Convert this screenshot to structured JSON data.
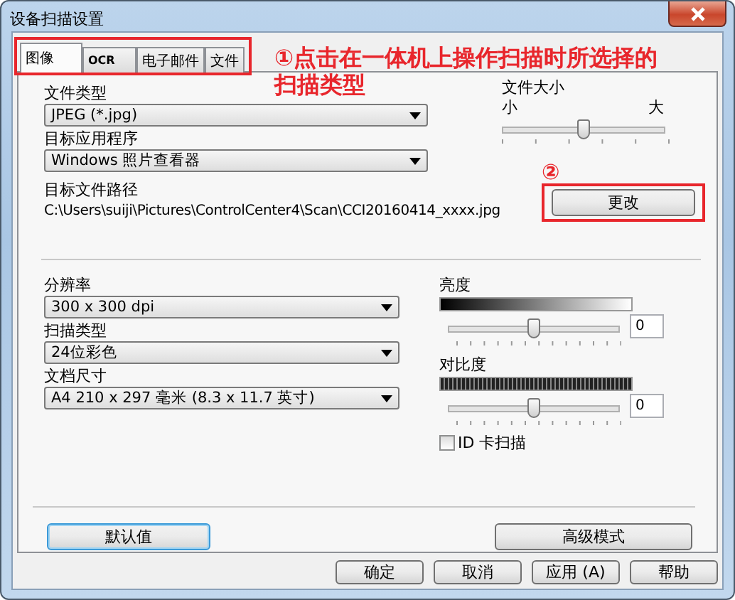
{
  "window": {
    "title": "设备扫描设置"
  },
  "tabs": [
    {
      "label": "图像",
      "selected": true
    },
    {
      "label": "OCR",
      "selected": false
    },
    {
      "label": "电子邮件",
      "selected": false
    },
    {
      "label": "文件",
      "selected": false
    }
  ],
  "tab_note": [
    "①点击在一体机上操作扫描时所选择的",
    "扫描类型"
  ],
  "file_type": {
    "label": "文件类型",
    "value": "JPEG (*.jpg)"
  },
  "file_size": {
    "label": "文件大小",
    "min_label": "小",
    "max_label": "大",
    "level": 0.5
  },
  "target_app": {
    "label": "目标应用程序",
    "value": "Windows 照片查看器"
  },
  "target_path": {
    "label": "目标文件路径",
    "value": "C:\\Users\\suiji\\Pictures\\ControlCenter4\\Scan\\CCI20160414_xxxx.jpg"
  },
  "change_button": {
    "note": "②",
    "label": "更改"
  },
  "resolution": {
    "label": "分辨率",
    "value": "300 x 300 dpi"
  },
  "scan_type": {
    "label": "扫描类型",
    "value": "24位彩色"
  },
  "document_size": {
    "label": "文档尺寸",
    "value": "A4 210 x 297 毫米 (8.3 x 11.7 英寸)"
  },
  "brightness": {
    "label": "亮度",
    "level": 0.5,
    "value": "0"
  },
  "contrast": {
    "label": "对比度",
    "level": 0.5,
    "value": "0"
  },
  "id_card_scan": {
    "label": "ID 卡扫描",
    "checked": false
  },
  "default_button": "默认值",
  "advanced_button": "高级模式",
  "footer_buttons": [
    "确定",
    "取消",
    "应用 (A)",
    "帮助"
  ]
}
